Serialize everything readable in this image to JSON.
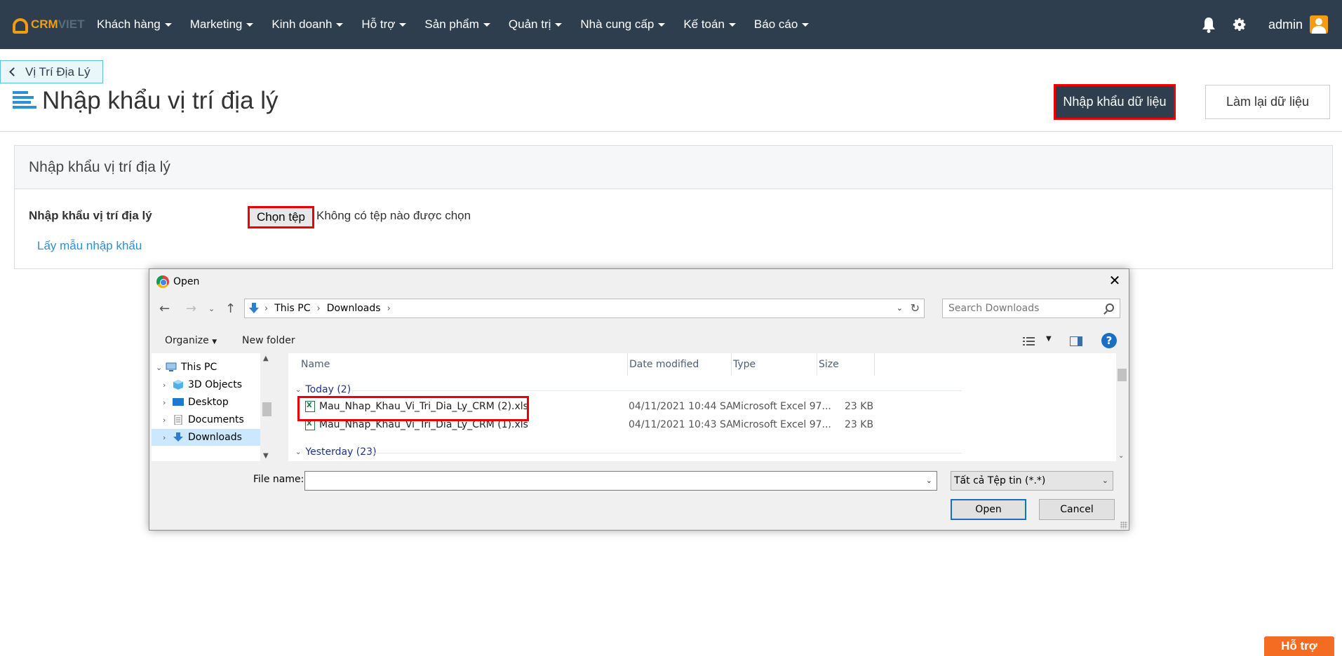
{
  "app": {
    "logo_crm": "CRM",
    "logo_viet": "VIET"
  },
  "nav": {
    "items": [
      "Khách hàng",
      "Marketing",
      "Kinh doanh",
      "Hỗ trợ",
      "Sản phẩm",
      "Quản trị",
      "Nhà cung cấp",
      "Kế toán",
      "Báo cáo"
    ],
    "user": "admin"
  },
  "page": {
    "back_label": "Vị Trí Địa Lý",
    "title": "Nhập khẩu vị trí địa lý",
    "import_button": "Nhập khẩu dữ liệu",
    "reset_button": "Làm lại dữ liệu"
  },
  "panel": {
    "heading": "Nhập khẩu vị trí địa lý",
    "field_label": "Nhập khẩu vị trí địa lý",
    "choose_file": "Chọn tệp",
    "no_file": "Không có tệp nào được chọn",
    "sample_link": "Lấy mẫu nhập khẩu"
  },
  "dialog": {
    "title": "Open",
    "path": [
      "This PC",
      "Downloads"
    ],
    "search_placeholder": "Search Downloads",
    "organize": "Organize",
    "new_folder": "New folder",
    "help": "?",
    "tree": [
      {
        "label": "This PC",
        "icon": "computer-icon"
      },
      {
        "label": "3D Objects",
        "icon": "cube-icon"
      },
      {
        "label": "Desktop",
        "icon": "desktop-icon"
      },
      {
        "label": "Documents",
        "icon": "document-icon"
      },
      {
        "label": "Downloads",
        "icon": "download-icon",
        "selected": true
      }
    ],
    "columns": {
      "name": "Name",
      "date": "Date modified",
      "type": "Type",
      "size": "Size"
    },
    "groups": [
      {
        "label": "Today (2)",
        "files": [
          {
            "name": "Mau_Nhap_Khau_Vi_Tri_Dia_Ly_CRM (2).xls",
            "date": "04/11/2021 10:44 SA",
            "type": "Microsoft Excel 97...",
            "size": "23 KB"
          },
          {
            "name": "Mau_Nhap_Khau_Vi_Tri_Dia_Ly_CRM (1).xls",
            "date": "04/11/2021 10:43 SA",
            "type": "Microsoft Excel 97...",
            "size": "23 KB"
          }
        ]
      },
      {
        "label": "Yesterday (23)"
      }
    ],
    "file_name_label": "File name:",
    "file_name_value": "",
    "file_type": "Tất cả Tệp tin (*.*)",
    "open_button": "Open",
    "cancel_button": "Cancel"
  },
  "support_button": "Hỗ trợ",
  "colors": {
    "nav_bg": "#2e3e4e",
    "accent": "#f39c12",
    "link": "#2d8fd5",
    "highlight": "#ee0000",
    "support": "#f36c21"
  }
}
